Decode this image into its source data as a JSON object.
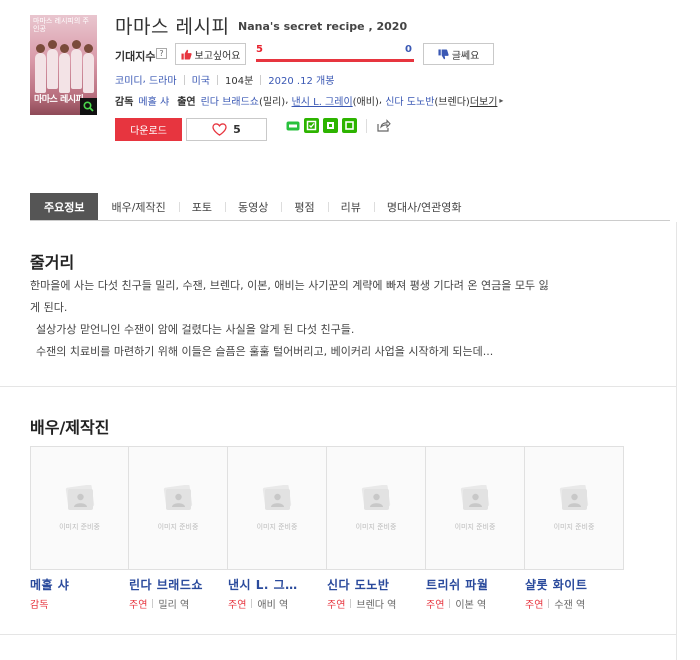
{
  "movie": {
    "title_kr": "마마스 레시피",
    "title_en": "Nana's secret recipe , 2020",
    "poster_caption": "마마스 레시피",
    "poster_tagline": "마마스 레시피의 주인공",
    "anticipation_label": "기대지수",
    "help_icon": "?",
    "want_label": "보고싶어요",
    "dislike_label": "글쎄요",
    "want_count": "5",
    "dislike_count": "0",
    "want_ratio": 1.0,
    "genres": [
      "코미디",
      "드라마"
    ],
    "country": "미국",
    "runtime": "104분",
    "release": "2020 .12 개봉",
    "director_label": "감독",
    "director": "메홀 샤",
    "cast_label": "출연",
    "cast_credits": [
      {
        "name": "린다 브래드쇼",
        "role": "(밀리)"
      },
      {
        "name": "낸시 L. 그레이",
        "role": "(애비)"
      },
      {
        "name": "신다 도노반",
        "role": "(브렌다)"
      }
    ],
    "more_label": "더보기",
    "download_label": "다운로드",
    "like_count": "5"
  },
  "tabs": [
    {
      "label": "주요정보",
      "active": true
    },
    {
      "label": "배우/제작진",
      "active": false
    },
    {
      "label": "포토",
      "active": false
    },
    {
      "label": "동영상",
      "active": false
    },
    {
      "label": "평점",
      "active": false
    },
    {
      "label": "리뷰",
      "active": false
    },
    {
      "label": "명대사/연관영화",
      "active": false
    }
  ],
  "synopsis": {
    "heading": "줄거리",
    "paragraphs": [
      "한마을에 사는 다섯 친구들 밀리, 수잰, 브렌다, 이본, 애비는 사기꾼의 계략에 빠져 평생 기다려 온 연금을 모두 잃",
      "게 된다.",
      "설상가상 맏언니인 수잰이 암에 걸렸다는 사실을 알게 된 다섯 친구들.",
      "수잰의 치료비를 마련하기 위해 이들은 슬픔은 훌훌 털어버리고, 베이커리 사업을 시작하게 되는데..."
    ]
  },
  "cast_section": {
    "heading": "배우/제작진",
    "placeholder_text": "이미지 준비중",
    "people": [
      {
        "name": "메홀 샤",
        "type": "감독",
        "role": ""
      },
      {
        "name": "린다 브래드쇼",
        "type": "주연",
        "role": "밀리 역"
      },
      {
        "name": "낸시 L. 그…",
        "type": "주연",
        "role": "애비 역"
      },
      {
        "name": "신다 도노반",
        "type": "주연",
        "role": "브렌다 역"
      },
      {
        "name": "트리쉬 파월",
        "type": "주연",
        "role": "이본 역"
      },
      {
        "name": "샬롯 화이트",
        "type": "주연",
        "role": "수잰 역"
      }
    ]
  },
  "colors": {
    "accent_red": "#e7353f",
    "link_blue": "#3a58b4",
    "name_blue": "#2a4a9c",
    "tab_active_bg": "#555555"
  },
  "icons": [
    "magnify-icon",
    "thumbs-up-icon",
    "thumbs-down-icon",
    "heart-icon",
    "band-icon",
    "kakao-icon",
    "naver-icon",
    "share-icon",
    "person-placeholder-icon"
  ]
}
